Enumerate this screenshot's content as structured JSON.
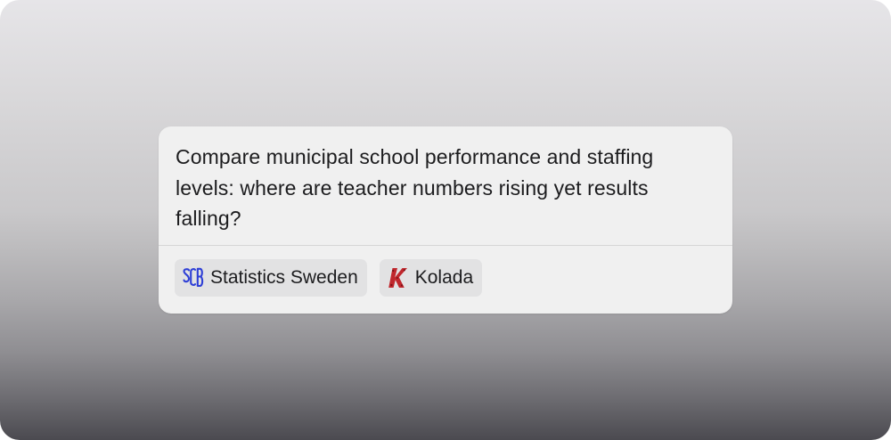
{
  "card": {
    "prompt": "Compare municipal school performance and staffing levels: where are teacher numbers rising yet results falling?",
    "sources": [
      {
        "label": "Statistics Sweden",
        "icon": "scb-logo-icon",
        "color": "#2e3fd6"
      },
      {
        "label": "Kolada",
        "icon": "kolada-logo-icon",
        "color": "#c0272d"
      }
    ]
  }
}
